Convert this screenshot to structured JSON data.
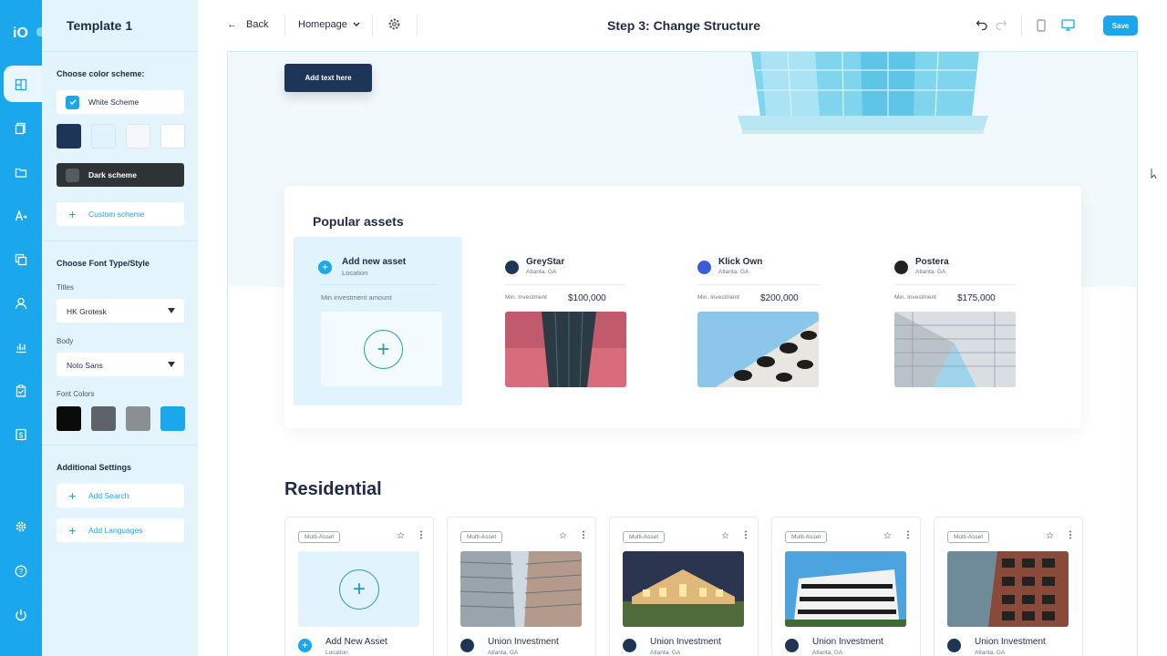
{
  "app": {
    "logo": "iO"
  },
  "panel": {
    "title": "Template 1",
    "color_scheme_heading": "Choose color scheme:",
    "white_scheme": "White Scheme",
    "dark_scheme": "Dark scheme",
    "custom_scheme": "Custom scheme",
    "scheme_swatches": [
      "#1d3557",
      "#e1f3fc",
      "#f4f8fa",
      "#ffffff"
    ],
    "font_heading": "Choose Font Type/Style",
    "titles_label": "Titles",
    "titles_font": "HK Grotesk",
    "body_label": "Body",
    "body_font": "Noto Sans",
    "font_colors_label": "Font Colors",
    "font_color_swatches": [
      "#0b0b0b",
      "#5d6368",
      "#8a8f94",
      "#1aa7ec"
    ],
    "additional_heading": "Additional Settings",
    "add_search": "Add Search",
    "add_languages": "Add Languages"
  },
  "topbar": {
    "back": "Back",
    "page_select": "Homepage",
    "step_title": "Step 3: Change Structure",
    "save": "Save"
  },
  "hero": {
    "button": "Add text here"
  },
  "popular": {
    "title": "Popular assets",
    "add_new_asset": "Add new asset",
    "add_location": "Location",
    "min_investment_amount": "Min investment amount",
    "assets": [
      {
        "name": "GreyStar",
        "location": "Atlanta, GA",
        "min_label": "Min. Investment",
        "amount": "$100,000"
      },
      {
        "name": "Klick Own",
        "location": "Atlanta, GA",
        "min_label": "Min. Investment",
        "amount": "$200,000"
      },
      {
        "name": "Postera",
        "location": "Atlanta, GA",
        "min_label": "Min. Investment",
        "amount": "$175,000"
      }
    ]
  },
  "residential": {
    "title": "Residential",
    "cards": [
      {
        "tag": "Multi-Asset",
        "name": "Add New Asset",
        "location": "Location"
      },
      {
        "tag": "Multi-Asset",
        "name": "Union Investment",
        "location": "Atlanta, GA"
      },
      {
        "tag": "Multi-Asset",
        "name": "Union Investment",
        "location": "Atlanta, GA"
      },
      {
        "tag": "Multi-Asset",
        "name": "Union Investment",
        "location": "Atlanta, GA"
      },
      {
        "tag": "Multi-Asset",
        "name": "Union Investment",
        "location": "Atlanta, GA"
      }
    ]
  },
  "colors": {
    "accent": "#1aa7ec",
    "navy": "#1d3557",
    "panel_bg": "#e3f4fc"
  }
}
